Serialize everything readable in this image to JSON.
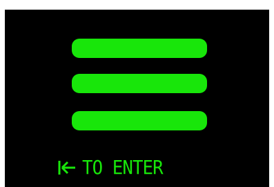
{
  "screen": {
    "background": "#000000",
    "accent": "#18e60a",
    "menu_icon": "hamburger-menu-icon",
    "hint": {
      "icon": "enter-key-icon",
      "text": "TO ENTER"
    }
  }
}
